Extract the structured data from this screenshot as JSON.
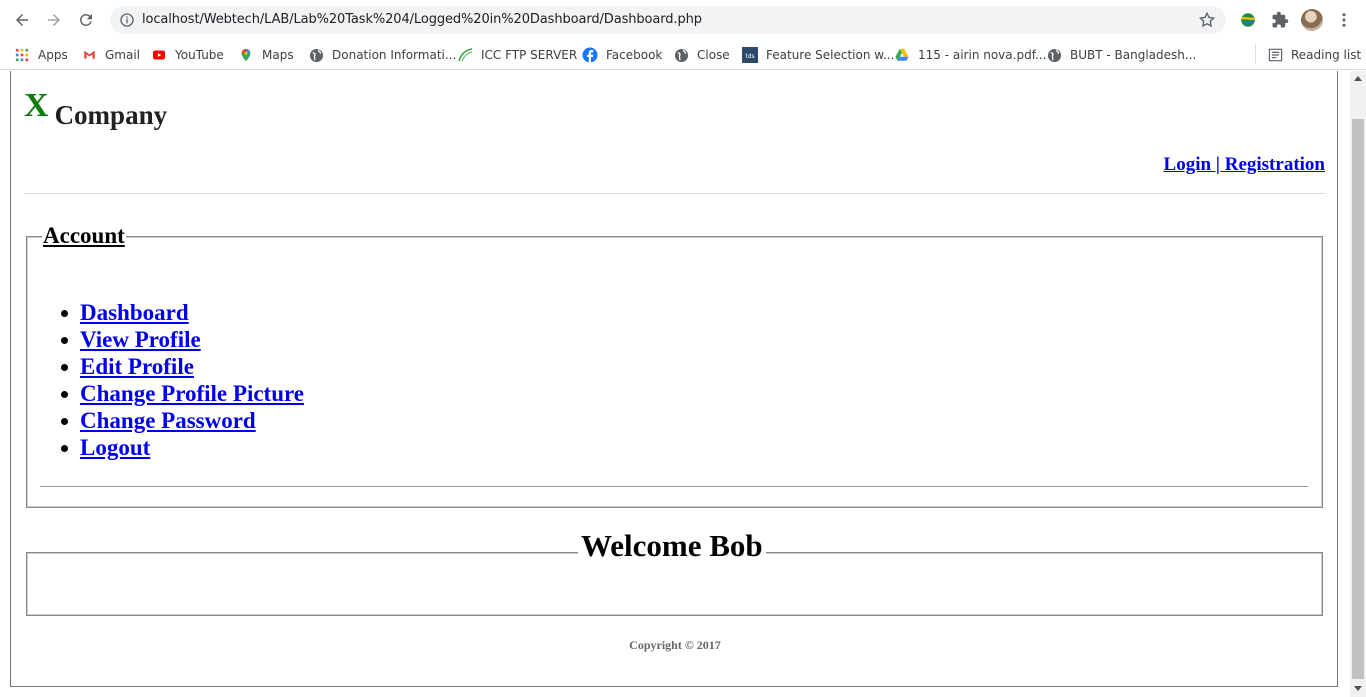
{
  "browser": {
    "url": "localhost/Webtech/LAB/Lab%20Task%204/Logged%20in%20Dashboard/Dashboard.php",
    "bookmarks": [
      {
        "label": "Apps",
        "icon": "apps-grid-icon"
      },
      {
        "label": "Gmail",
        "icon": "gmail-icon"
      },
      {
        "label": "YouTube",
        "icon": "youtube-icon"
      },
      {
        "label": "Maps",
        "icon": "maps-icon"
      },
      {
        "label": "Donation Informati...",
        "icon": "globe-icon"
      },
      {
        "label": "ICC FTP SERVER",
        "icon": "ftp-icon"
      },
      {
        "label": "Facebook",
        "icon": "facebook-icon"
      },
      {
        "label": "Close",
        "icon": "globe-icon"
      },
      {
        "label": "Feature Selection w...",
        "icon": "tds-icon"
      },
      {
        "label": "115 - airin nova.pdf...",
        "icon": "drive-icon"
      },
      {
        "label": "BUBT - Bangladesh...",
        "icon": "globe-icon"
      }
    ],
    "reading_list": "Reading list"
  },
  "page": {
    "brand_mark": "X",
    "brand_name": "Company",
    "auth_link": "Login | Registration",
    "account_legend": "Account",
    "menu": [
      "Dashboard",
      "View Profile",
      "Edit Profile",
      "Change Profile Picture",
      "Change Password",
      "Logout"
    ],
    "welcome": "Welcome Bob",
    "copyright": "Copyright © 2017"
  },
  "colors": {
    "brand_mark": "#0a7d0a",
    "link": "#0000ee"
  }
}
